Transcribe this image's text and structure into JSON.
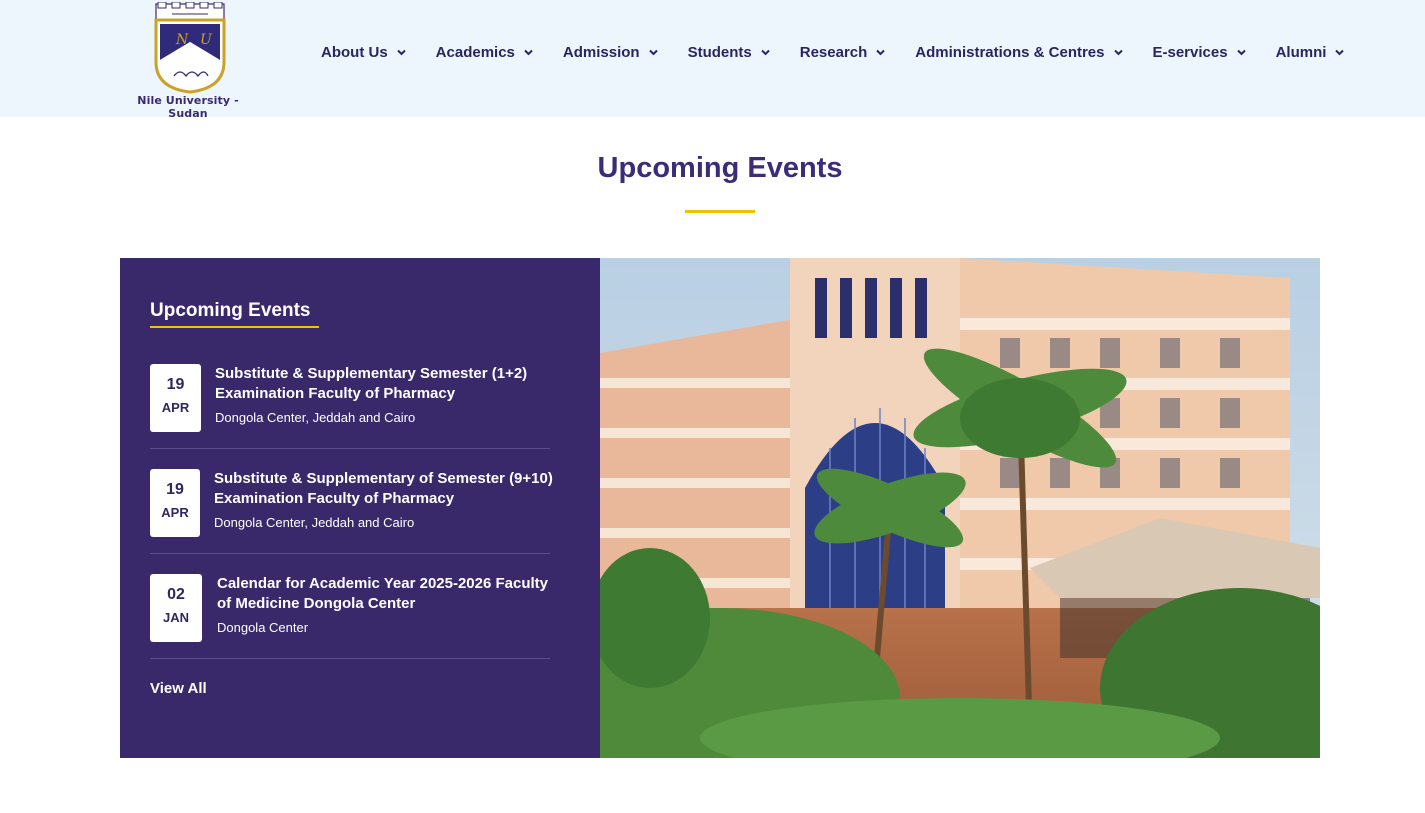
{
  "header": {
    "logo_text": "Nile University - Sudan",
    "nav": [
      {
        "label": "About Us"
      },
      {
        "label": "Academics"
      },
      {
        "label": "Admission"
      },
      {
        "label": "Students"
      },
      {
        "label": "Research"
      },
      {
        "label": "Administrations & Centres"
      },
      {
        "label": "E-services"
      },
      {
        "label": "Alumni"
      }
    ]
  },
  "section": {
    "title": "Upcoming Events"
  },
  "panel": {
    "heading": "Upcoming Events",
    "events": [
      {
        "day": "19",
        "month": "APR",
        "title": "Substitute & Supplementary Semester (1+2) Examination Faculty of Pharmacy",
        "location": "Dongola Center, Jeddah and Cairo"
      },
      {
        "day": "19",
        "month": "APR",
        "title": "Substitute & Supplementary of Semester (9+10) Examination Faculty of Pharmacy",
        "location": "Dongola Center, Jeddah and Cairo"
      },
      {
        "day": "02",
        "month": "JAN",
        "title": "Calendar for Academic Year 2025-2026 Faculty of Medicine Dongola Center",
        "location": "Dongola Center"
      }
    ],
    "view_all": "View All"
  },
  "colors": {
    "brand_purple": "#39296b",
    "accent_yellow": "#f2c200",
    "header_bg": "#eef6fd"
  },
  "icons": {
    "nav_chevron": "chevron-down-icon",
    "logo": "nile-university-crest-icon"
  }
}
